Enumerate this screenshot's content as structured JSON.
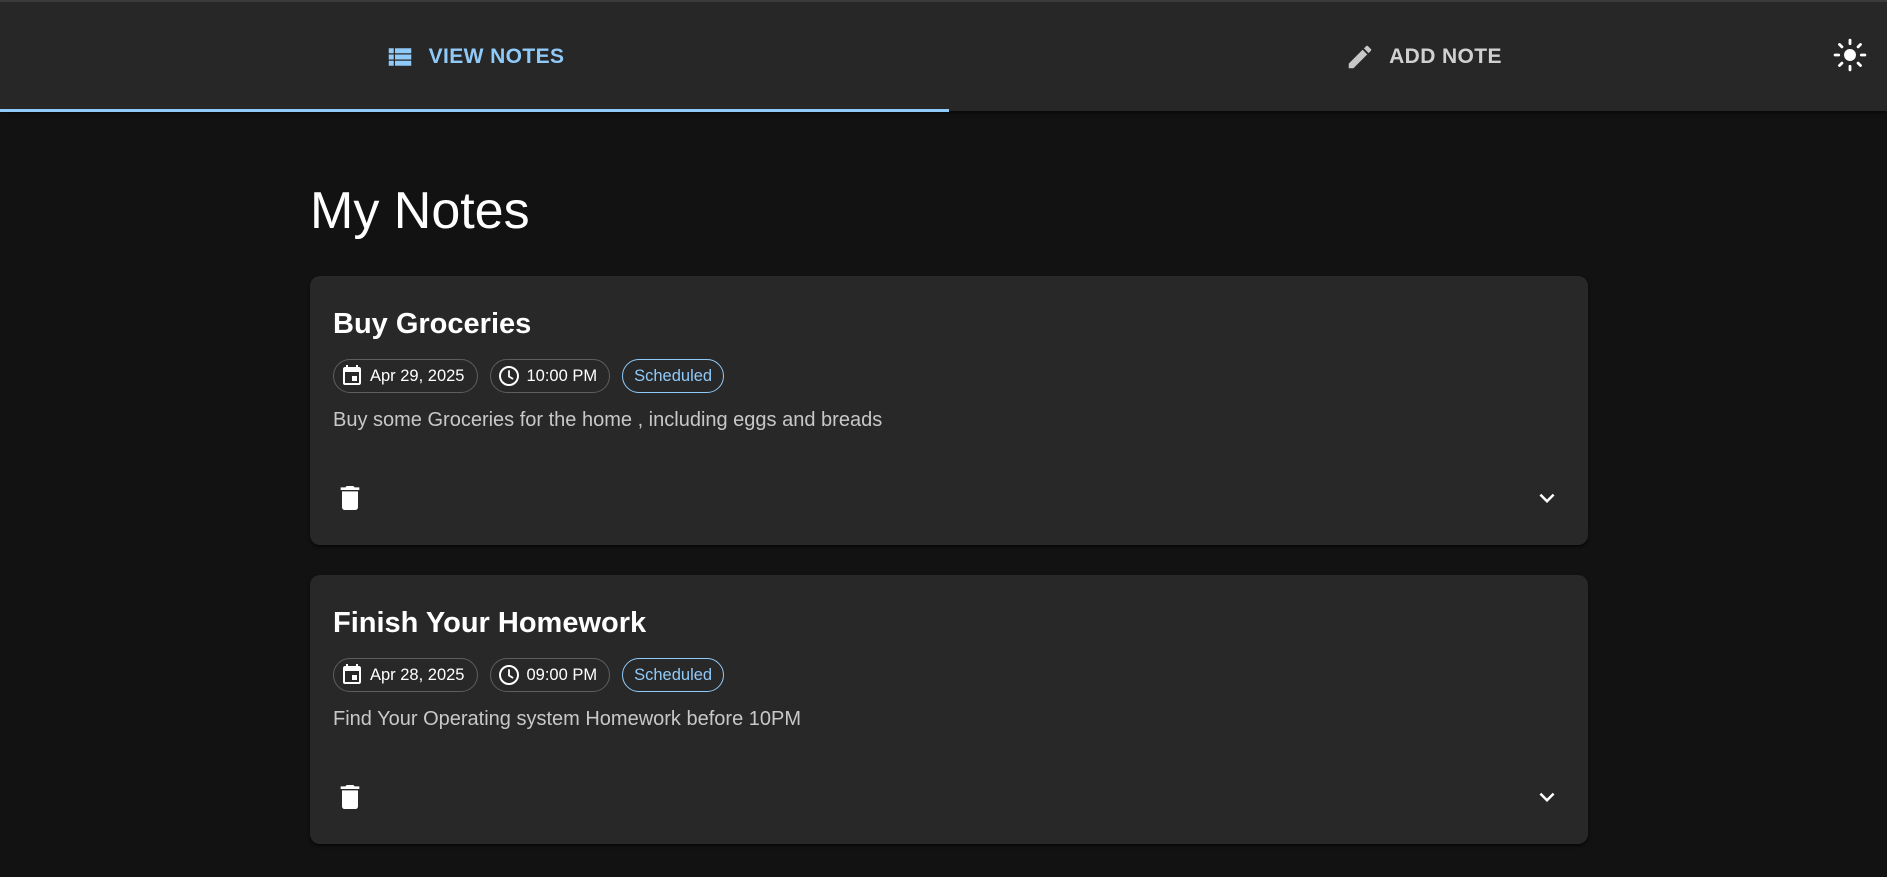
{
  "tabs": [
    {
      "label": "VIEW NOTES",
      "icon": "list-icon",
      "selected": true
    },
    {
      "label": "ADD NOTE",
      "icon": "pencil-icon",
      "selected": false
    }
  ],
  "theme_toggle": {
    "icon": "sun-icon"
  },
  "page": {
    "title": "My Notes"
  },
  "notes": [
    {
      "title": "Buy Groceries",
      "date": "Apr 29, 2025",
      "time": "10:00 PM",
      "status": "Scheduled",
      "description": "Buy some Groceries for the home , including eggs and breads"
    },
    {
      "title": "Finish Your Homework",
      "date": "Apr 28, 2025",
      "time": "09:00 PM",
      "status": "Scheduled",
      "description": "Find Your Operating system Homework before 10PM"
    }
  ],
  "colors": {
    "accent": "#90caf9",
    "background": "#121212",
    "surface": "#282828",
    "appbar": "#272727"
  }
}
